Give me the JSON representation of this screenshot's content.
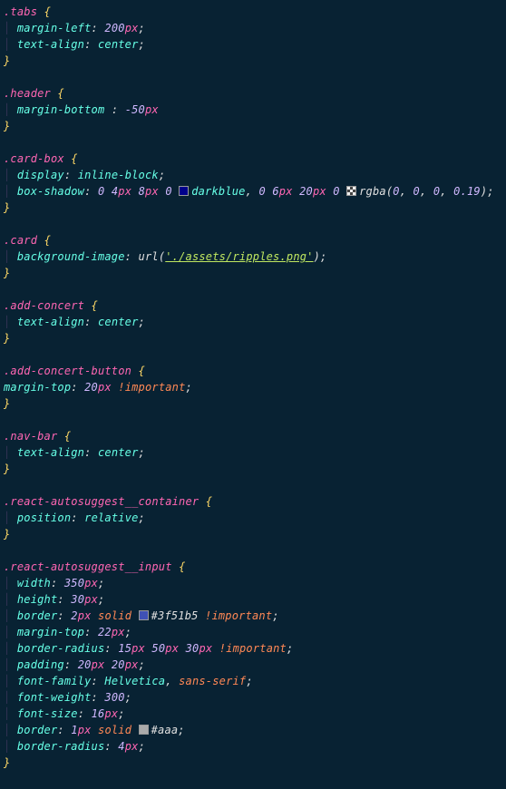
{
  "rules": [
    {
      "selector": ".tabs",
      "declarations": [
        {
          "property": "margin-left",
          "number": "200",
          "unit": "px",
          "trailingSemicolon": true
        },
        {
          "property": "text-align",
          "identValue": "center",
          "trailingSemicolon": true
        }
      ]
    },
    {
      "selector": ".header",
      "declarations": [
        {
          "property": "margin-bottom",
          "spaceBeforeColon": true,
          "number": "-50",
          "unit": "px",
          "trailingSemicolon": false
        }
      ]
    },
    {
      "selector": ".card-box",
      "declarations": [
        {
          "property": "display",
          "identValue": "inline-block",
          "trailingSemicolon": true
        },
        {
          "property": "box-shadow",
          "shadowParts": [
            {
              "numbers": [
                "0",
                "4",
                "8",
                "0"
              ],
              "units": [
                "",
                "px",
                "px",
                ""
              ],
              "swatch": "darkblue",
              "colorIdent": "darkblue"
            },
            {
              "numbers": [
                "0",
                "6",
                "20",
                "0"
              ],
              "units": [
                "",
                "px",
                "px",
                ""
              ],
              "swatch": "trans",
              "colorFunc": "rgba",
              "colorArgs": [
                "0",
                "0",
                "0",
                "0.19"
              ]
            }
          ],
          "trailingSemicolon": true
        }
      ]
    },
    {
      "selector": ".card",
      "declarations": [
        {
          "property": "background-image",
          "urlValue": "'./assets/ripples.png'",
          "trailingSemicolon": true
        }
      ]
    },
    {
      "selector": ".add-concert",
      "declarations": [
        {
          "property": "text-align",
          "identValue": "center",
          "trailingSemicolon": true
        }
      ]
    },
    {
      "selector": ".add-concert-button",
      "declarations": [
        {
          "property": "margin-top",
          "noIndent": true,
          "number": "20",
          "unit": "px",
          "important": true,
          "trailingSemicolon": true
        }
      ]
    },
    {
      "selector": ".nav-bar",
      "declarations": [
        {
          "property": "text-align",
          "identValue": "center",
          "trailingSemicolon": true
        }
      ]
    },
    {
      "selector": ".react-autosuggest__container",
      "declarations": [
        {
          "property": "position",
          "identValue": "relative",
          "trailingSemicolon": true
        }
      ]
    },
    {
      "selector": ".react-autosuggest__input",
      "declarations": [
        {
          "property": "width",
          "number": "350",
          "unit": "px",
          "trailingSemicolon": true
        },
        {
          "property": "height",
          "number": "30",
          "unit": "px",
          "trailingSemicolon": true
        },
        {
          "property": "border",
          "number": "2",
          "unit": "px",
          "keyword": "solid",
          "swatch": "indigo",
          "hex": "#3f51b5",
          "important": true,
          "trailingSemicolon": true
        },
        {
          "property": "margin-top",
          "number": "22",
          "unit": "px",
          "trailingSemicolon": true
        },
        {
          "property": "border-radius",
          "multiNumbers": [
            "15",
            "50",
            "30"
          ],
          "multiUnits": [
            "px",
            "px",
            "px"
          ],
          "important": true,
          "trailingSemicolon": true
        },
        {
          "property": "padding",
          "multiNumbers": [
            "20",
            "20"
          ],
          "multiUnits": [
            "px",
            "px"
          ],
          "trailingSemicolon": true
        },
        {
          "property": "font-family",
          "fontNames": [
            "Helvetica",
            "sans-serif"
          ],
          "trailingSemicolon": true
        },
        {
          "property": "font-weight",
          "number": "300",
          "trailingSemicolon": true
        },
        {
          "property": "font-size",
          "number": "16",
          "unit": "px",
          "trailingSemicolon": true
        },
        {
          "property": "border",
          "number": "1",
          "unit": "px",
          "keyword": "solid",
          "swatch": "aaa",
          "hex": "#aaa",
          "trailingSemicolon": true
        },
        {
          "property": "border-radius",
          "number": "4",
          "unit": "px",
          "trailingSemicolon": true
        }
      ]
    }
  ]
}
